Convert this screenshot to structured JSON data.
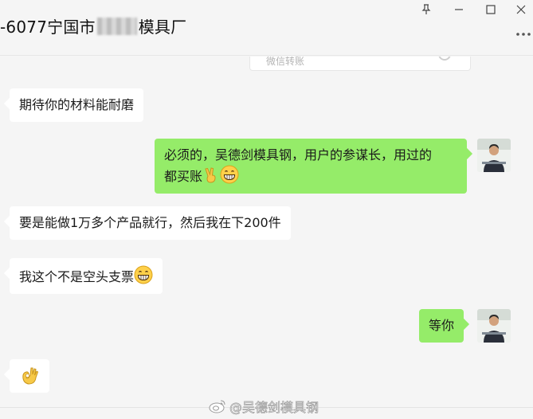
{
  "window": {
    "title_prefix": "-6077宁国市",
    "title_suffix": "模具厂",
    "title_redacted": true
  },
  "controls": {
    "pin_icon": "pin-icon",
    "minimize_icon": "minimize-icon",
    "maximize_icon": "maximize-icon",
    "close_icon": "close-icon",
    "more_icon": "more-icon"
  },
  "transfer_card": {
    "label": "微信转账"
  },
  "messages": [
    {
      "side": "in",
      "text": "期待你的材料能耐磨"
    },
    {
      "side": "out",
      "line1": "必须的，吴德剑模具钢，用户的参谋长，用过的",
      "line2": "都买账",
      "emojis": [
        "victory-hand",
        "grinning-face"
      ]
    },
    {
      "side": "in",
      "text": "要是能做1万多个产品就行，然后我在下200件"
    },
    {
      "side": "in",
      "text": "我这个不是空头支票",
      "emojis": [
        "grinning-face"
      ]
    },
    {
      "side": "out",
      "text": "等你"
    },
    {
      "side": "in",
      "emojis": [
        "ok-hand"
      ]
    }
  ],
  "watermark": {
    "text": "@吴德剑模具钢"
  },
  "colors": {
    "outgoing_bubble": "#95ec69",
    "incoming_bubble": "#ffffff",
    "chat_background": "#f5f5f5"
  }
}
